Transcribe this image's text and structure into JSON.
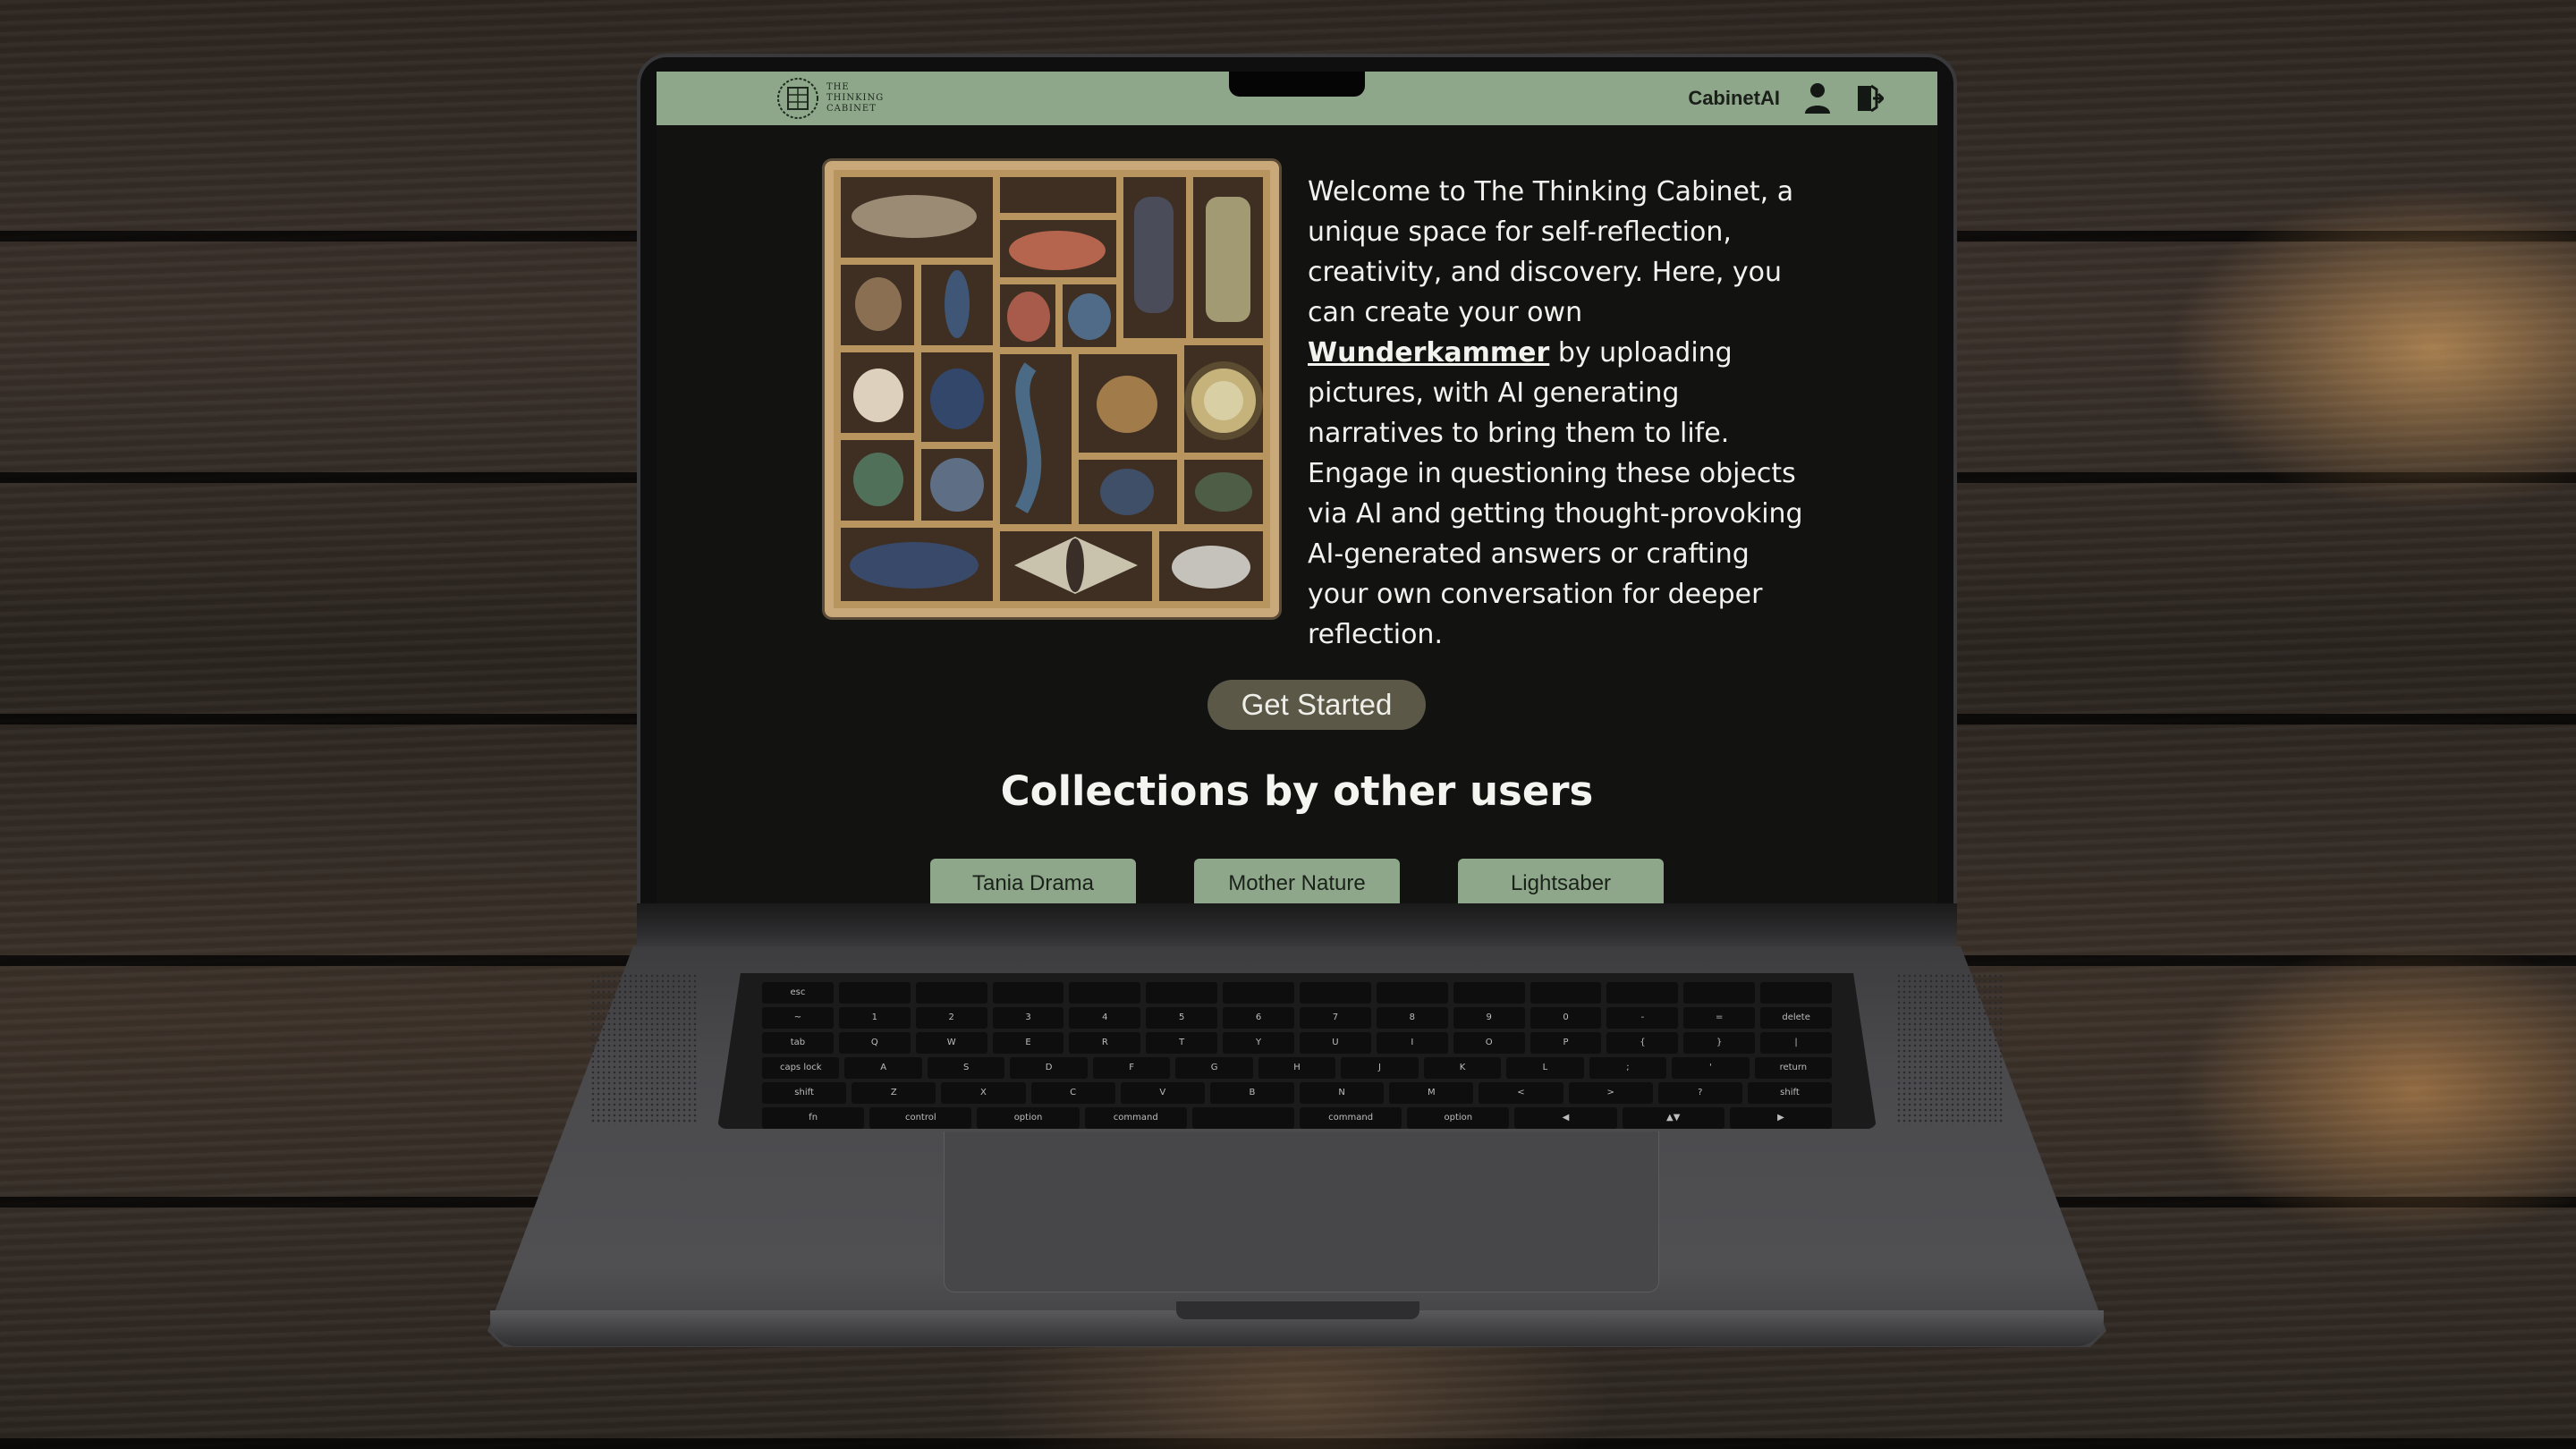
{
  "navbar": {
    "logo_text_line1": "THE",
    "logo_text_line2": "THINKING",
    "logo_text_line3": "CABINET",
    "brand_link": "CabinetAI",
    "profile_icon": "user-icon",
    "logout_icon": "logout-icon",
    "background_color": "#8ea78a"
  },
  "hero": {
    "image_description_icon": "curiosity-cabinet-image",
    "intro_before_link": "Welcome to The Thinking Cabinet, a unique space for self-reflection, creativity, and discovery. Here, you can create your own ",
    "link_text": "Wunderkammer",
    "intro_after_link": " by uploading pictures, with AI generating narratives to bring them to life. Engage in questioning these objects via AI and getting thought-provoking AI-generated answers or crafting your own conversation for deeper reflection.",
    "cta_label": "Get Started"
  },
  "collections": {
    "title": "Collections by other users",
    "items": [
      {
        "label": "Tania Drama"
      },
      {
        "label": "Mother Nature"
      },
      {
        "label": "Lightsaber"
      }
    ]
  },
  "keyboard": {
    "row1": [
      "esc",
      "",
      "",
      "",
      "",
      "",
      "",
      "",
      "",
      "",
      "",
      "",
      "",
      ""
    ],
    "row2": [
      "~",
      "1",
      "2",
      "3",
      "4",
      "5",
      "6",
      "7",
      "8",
      "9",
      "0",
      "-",
      "=",
      "delete"
    ],
    "row3": [
      "tab",
      "Q",
      "W",
      "E",
      "R",
      "T",
      "Y",
      "U",
      "I",
      "O",
      "P",
      "{",
      "}",
      "|"
    ],
    "row4": [
      "caps lock",
      "A",
      "S",
      "D",
      "F",
      "G",
      "H",
      "J",
      "K",
      "L",
      ";",
      "'",
      "return"
    ],
    "row5": [
      "shift",
      "Z",
      "X",
      "C",
      "V",
      "B",
      "N",
      "M",
      "<",
      ">",
      "?",
      "shift"
    ],
    "row6": [
      "fn",
      "control",
      "option",
      "command",
      "",
      "command",
      "option",
      "◀",
      "▲▼",
      "▶"
    ]
  }
}
